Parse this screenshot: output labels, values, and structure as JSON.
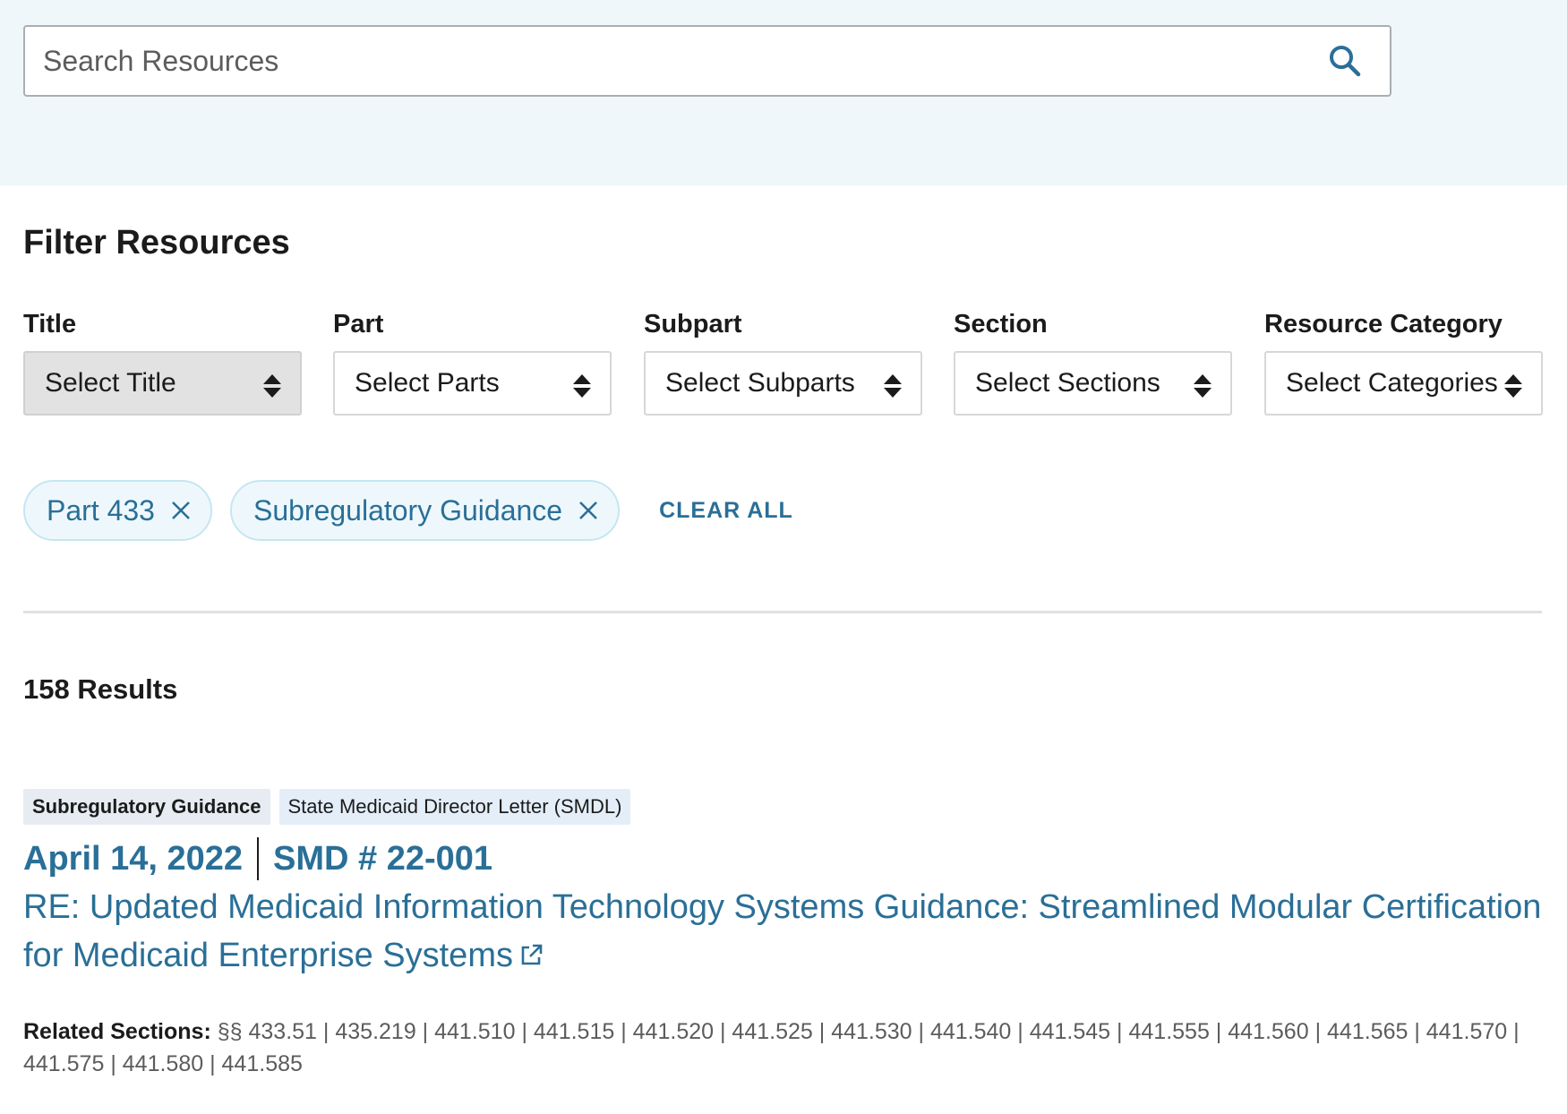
{
  "search": {
    "placeholder": "Search Resources"
  },
  "filters": {
    "heading": "Filter Resources",
    "groups": [
      {
        "label": "Title",
        "placeholder": "Select Title",
        "disabled": true
      },
      {
        "label": "Part",
        "placeholder": "Select Parts",
        "disabled": false
      },
      {
        "label": "Subpart",
        "placeholder": "Select Subparts",
        "disabled": false
      },
      {
        "label": "Section",
        "placeholder": "Select Sections",
        "disabled": false
      },
      {
        "label": "Resource Category",
        "placeholder": "Select Categories",
        "disabled": false
      }
    ]
  },
  "active_filters": {
    "chips": [
      "Part 433",
      "Subregulatory Guidance"
    ],
    "clear_all": "CLEAR ALL"
  },
  "results": {
    "count_text": "158 Results",
    "items": [
      {
        "tags": [
          "Subregulatory Guidance",
          "State Medicaid Director Letter (SMDL)"
        ],
        "date": "April 14, 2022",
        "doc_id": "SMD # 22-001",
        "title": "RE: Updated Medicaid Information Technology Systems Guidance: Streamlined Modular Certification for Medicaid Enterprise Systems",
        "related_label": "Related Sections:",
        "related_prefix": "§§",
        "related_sections": [
          "433.51",
          "435.219",
          "441.510",
          "441.515",
          "441.520",
          "441.525",
          "441.530",
          "441.540",
          "441.545",
          "441.555",
          "441.560",
          "441.565",
          "441.570",
          "441.575",
          "441.580",
          "441.585"
        ]
      }
    ]
  },
  "colors": {
    "accent": "#2a6f97",
    "band": "#f0f7fa",
    "chip_bg": "#eef8fc",
    "chip_border": "#c5e6f3"
  }
}
